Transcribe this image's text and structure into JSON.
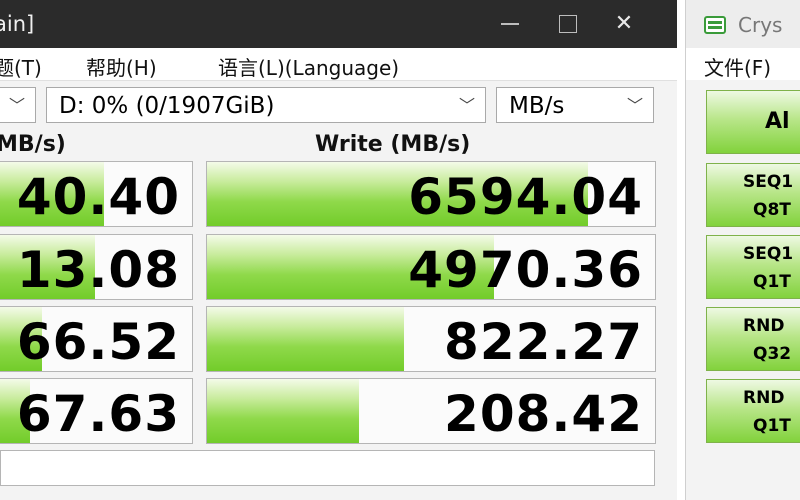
{
  "left_window": {
    "title": "ain]",
    "menu": [
      "题(T)",
      "帮助(H)",
      "语言(L)(Language)"
    ],
    "drive_select": "D: 0% (0/1907GiB)",
    "unit_select": "MB/s",
    "read_header": "MB/s)",
    "write_header": "Write (MB/s)",
    "rows": [
      {
        "read": "40.40",
        "read_fill": 0.55,
        "write": "6594.04",
        "write_fill": 0.85
      },
      {
        "read": "13.08",
        "read_fill": 0.5,
        "write": "4970.36",
        "write_fill": 0.64
      },
      {
        "read": "66.52",
        "read_fill": 0.23,
        "write": "822.27",
        "write_fill": 0.44
      },
      {
        "read": "67.63",
        "read_fill": 0.17,
        "write": "208.42",
        "write_fill": 0.34
      }
    ]
  },
  "right_window": {
    "title": "Crys",
    "menu_item": "文件(F)",
    "all_button": "Al",
    "tests": [
      {
        "line1": "SEQ1",
        "line2": "Q8T"
      },
      {
        "line1": "SEQ1",
        "line2": "Q1T"
      },
      {
        "line1": "RND",
        "line2": "Q32"
      },
      {
        "line1": "RND",
        "line2": "Q1T"
      }
    ]
  }
}
